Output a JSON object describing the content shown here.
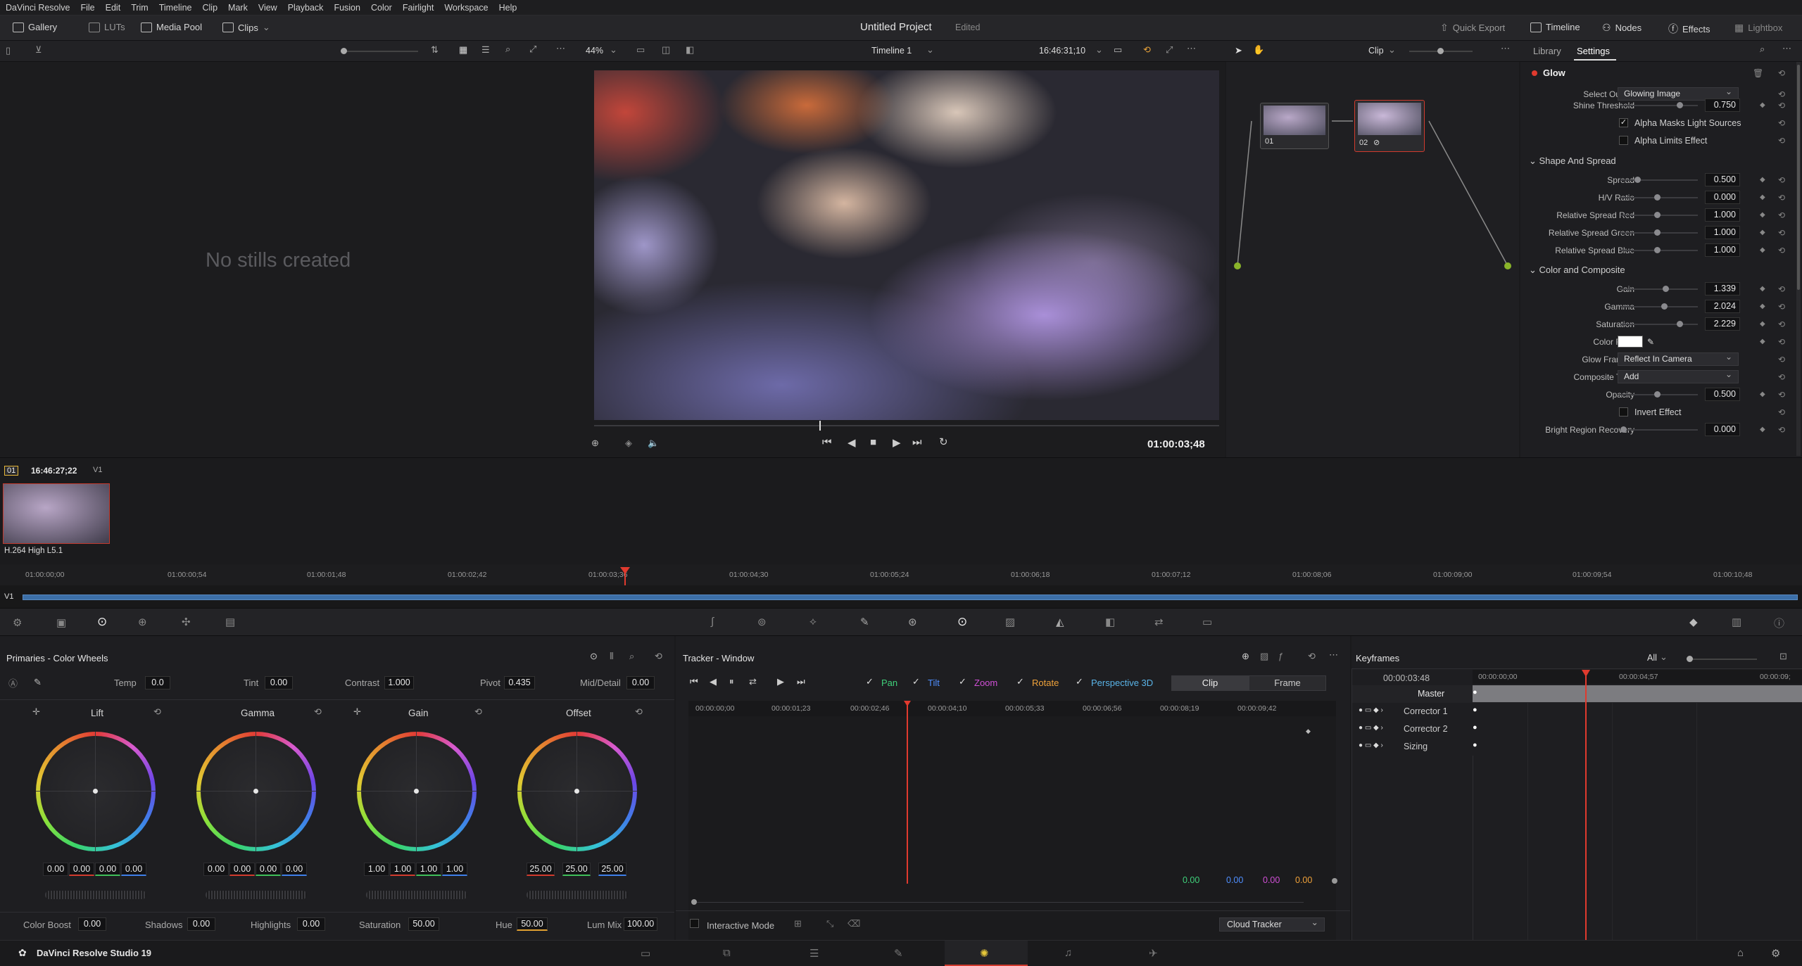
{
  "menubar": {
    "app": "DaVinci Resolve",
    "items": [
      "File",
      "Edit",
      "Trim",
      "Timeline",
      "Clip",
      "Mark",
      "View",
      "Playback",
      "Fusion",
      "Color",
      "Fairlight",
      "Workspace",
      "Help"
    ]
  },
  "toolbar": {
    "gallery": "Gallery",
    "luts": "LUTs",
    "media_pool": "Media Pool",
    "clips": "Clips",
    "project_title": "Untitled Project",
    "project_status": "Edited",
    "quick_export": "Quick Export",
    "timeline": "Timeline",
    "nodes": "Nodes",
    "effects": "Effects",
    "lightbox": "Lightbox"
  },
  "viewer": {
    "zoom": "44%",
    "timeline_name": "Timeline 1",
    "source_tc": "16:46:31;10",
    "clip_mode": "Clip",
    "record_tc": "01:00:03;48"
  },
  "gallery": {
    "empty_text": "No stills created"
  },
  "nodes": {
    "node1": "01",
    "node2": "02"
  },
  "settings": {
    "tab_library": "Library",
    "tab_settings": "Settings",
    "effect_name": "Glow",
    "select_output": {
      "label": "Select Output",
      "value": "Glowing Image"
    },
    "shine_threshold": {
      "label": "Shine Threshold",
      "value": "0.750"
    },
    "alpha_masks": "Alpha Masks Light Sources",
    "alpha_limits": "Alpha Limits Effect",
    "section_shape": "Shape And Spread",
    "spread": {
      "label": "Spread",
      "value": "0.500"
    },
    "hv_ratio": {
      "label": "H/V Ratio",
      "value": "0.000"
    },
    "rel_red": {
      "label": "Relative Spread Red",
      "value": "1.000"
    },
    "rel_green": {
      "label": "Relative Spread Green",
      "value": "1.000"
    },
    "rel_blue": {
      "label": "Relative Spread Blue",
      "value": "1.000"
    },
    "section_color": "Color and Composite",
    "gain": {
      "label": "Gain",
      "value": "1.339"
    },
    "gamma": {
      "label": "Gamma",
      "value": "2.024"
    },
    "saturation": {
      "label": "Saturation",
      "value": "2.229"
    },
    "color_filter": "Color Filter",
    "glow_framing": {
      "label": "Glow Framing",
      "value": "Reflect In Camera"
    },
    "composite_type": {
      "label": "Composite Type",
      "value": "Add"
    },
    "opacity": {
      "label": "Opacity",
      "value": "0.500"
    },
    "invert_effect": "Invert Effect",
    "bright_region": {
      "label": "Bright Region Recovery",
      "value": "0.000"
    }
  },
  "clip_strip": {
    "clip_number": "01",
    "clip_tc": "16:46:27;22",
    "track": "V1",
    "codec": "H.264 High L5.1"
  },
  "timeline_ruler": [
    "01:00:00;00",
    "01:00:00;54",
    "01:00:01;48",
    "01:00:02;42",
    "01:00:03;36",
    "01:00:04;30",
    "01:00:05;24",
    "01:00:06;18",
    "01:00:07;12",
    "01:00:08;06",
    "01:00:09;00",
    "01:00:09;54",
    "01:00:10;48"
  ],
  "track_label": "V1",
  "primaries": {
    "title": "Primaries - Color Wheels",
    "temp": {
      "label": "Temp",
      "value": "0.0"
    },
    "tint": {
      "label": "Tint",
      "value": "0.00"
    },
    "contrast": {
      "label": "Contrast",
      "value": "1.000"
    },
    "pivot": {
      "label": "Pivot",
      "value": "0.435"
    },
    "middetail": {
      "label": "Mid/Detail",
      "value": "0.00"
    },
    "wheels": [
      {
        "name": "Lift",
        "values": [
          "0.00",
          "0.00",
          "0.00",
          "0.00"
        ]
      },
      {
        "name": "Gamma",
        "values": [
          "0.00",
          "0.00",
          "0.00",
          "0.00"
        ]
      },
      {
        "name": "Gain",
        "values": [
          "1.00",
          "1.00",
          "1.00",
          "1.00"
        ]
      },
      {
        "name": "Offset",
        "values": [
          "25.00",
          "25.00",
          "25.00"
        ]
      }
    ],
    "color_boost": {
      "label": "Color Boost",
      "value": "0.00"
    },
    "shadows": {
      "label": "Shadows",
      "value": "0.00"
    },
    "highlights": {
      "label": "Highlights",
      "value": "0.00"
    },
    "saturation": {
      "label": "Saturation",
      "value": "50.00"
    },
    "hue": {
      "label": "Hue",
      "value": "50.00"
    },
    "lum_mix": {
      "label": "Lum Mix",
      "value": "100.00"
    }
  },
  "tracker": {
    "title": "Tracker - Window",
    "pan": "Pan",
    "tilt": "Tilt",
    "zoom": "Zoom",
    "rotate": "Rotate",
    "persp": "Perspective 3D",
    "tab_clip": "Clip",
    "tab_frame": "Frame",
    "ruler": [
      "00:00:00;00",
      "00:00:01;23",
      "00:00:02;46",
      "00:00:04;10",
      "00:00:05;33",
      "00:00:06;56",
      "00:00:08;19",
      "00:00:09;42"
    ],
    "vals": [
      "0.00",
      "0.00",
      "0.00",
      "0.00"
    ],
    "interactive_mode": "Interactive Mode",
    "cloud_tracker": "Cloud Tracker",
    "colors": {
      "pan": "#3fd07a",
      "tilt": "#4f8fff",
      "zoom": "#d04fd6",
      "rotate": "#f0a23a"
    }
  },
  "keyframes": {
    "title": "Keyframes",
    "filter": "All",
    "tc": "00:00:03:48",
    "ruler": [
      "00:00:00;00",
      "00:00:04;57",
      "00:00:09;"
    ],
    "rows": [
      "Master",
      "Corrector 1",
      "Corrector 2",
      "Sizing"
    ]
  },
  "bottombar": {
    "app_name": "DaVinci Resolve Studio 19"
  }
}
